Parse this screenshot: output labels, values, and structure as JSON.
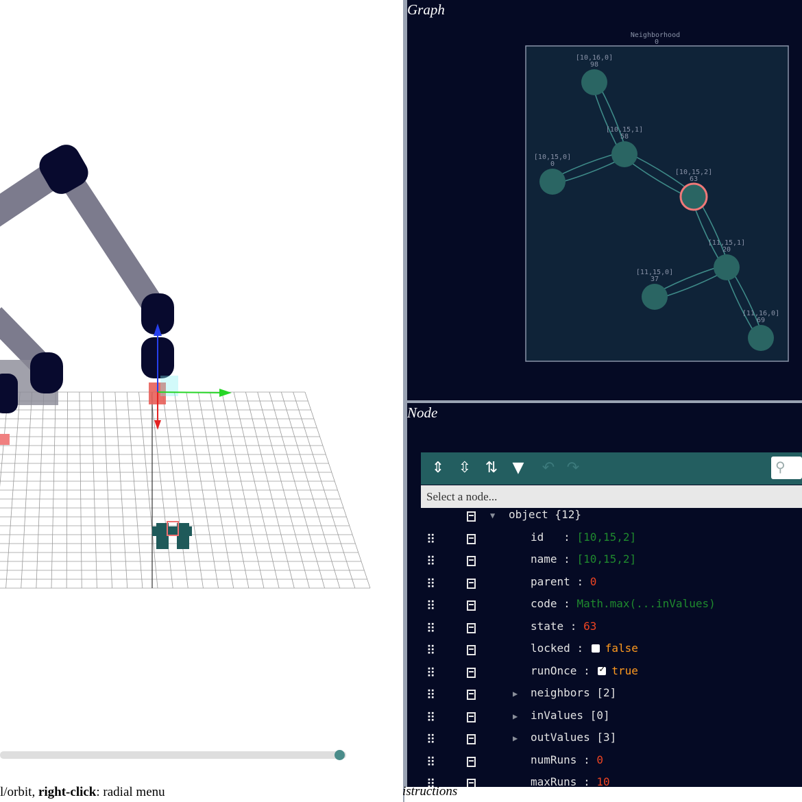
{
  "viewport": {
    "hint_prefix": "l/orbit, ",
    "hint_bold": "right-click",
    "hint_suffix": ": radial menu",
    "timeline_progress": 0.98
  },
  "graph": {
    "title": "Graph",
    "frame_title": "Neighborhood",
    "frame_subtitle": "0",
    "nodes": [
      {
        "id": "[10,16,0]",
        "value": "98"
      },
      {
        "id": "[10,15,1]",
        "value": "58"
      },
      {
        "id": "[10,15,0]",
        "value": "0"
      },
      {
        "id": "[10,15,2]",
        "value": "63",
        "selected": true
      },
      {
        "id": "[11,15,1]",
        "value": "20"
      },
      {
        "id": "[11,15,0]",
        "value": "37"
      },
      {
        "id": "[11,16,0]",
        "value": "69"
      }
    ],
    "colors": {
      "bg": "#050a24",
      "frame": "#0f2338",
      "node": "#2a6563",
      "selected": "#f07878"
    }
  },
  "node": {
    "title": "Node",
    "select_placeholder": "Select a node...",
    "toolbar": {
      "expand_icon": "expand-all-icon",
      "collapse_icon": "collapse-all-icon",
      "sort_icon": "sort-icon",
      "filter_icon": "filter-icon",
      "undo_icon": "undo-icon",
      "redo_icon": "redo-icon",
      "search_icon": "search-icon"
    },
    "tree": {
      "root_key": "object",
      "root_count": "{12}",
      "fields": [
        {
          "key": "id",
          "pad": "id   ",
          "value": "[10,15,2]",
          "type": "string"
        },
        {
          "key": "name",
          "pad": "name ",
          "value": "[10,15,2]",
          "type": "string"
        },
        {
          "key": "parent",
          "pad": "parent ",
          "value": "0",
          "type": "number"
        },
        {
          "key": "code",
          "pad": "code ",
          "value": "Math.max(...inValues)",
          "type": "string"
        },
        {
          "key": "state",
          "pad": "state ",
          "value": "63",
          "type": "number"
        },
        {
          "key": "locked",
          "pad": "locked ",
          "value": "false",
          "type": "boolean",
          "checked": false
        },
        {
          "key": "runOnce",
          "pad": "runOnce ",
          "value": "true",
          "type": "boolean",
          "checked": true
        },
        {
          "key": "neighbors",
          "pad": "neighbors",
          "value": "[2]",
          "type": "array"
        },
        {
          "key": "inValues",
          "pad": "inValues",
          "value": "[0]",
          "type": "array"
        },
        {
          "key": "outValues",
          "pad": "outValues",
          "value": "[3]",
          "type": "array"
        },
        {
          "key": "numRuns",
          "pad": "numRuns ",
          "value": "0",
          "type": "number"
        },
        {
          "key": "maxRuns",
          "pad": "maxRuns ",
          "value": "10",
          "type": "number"
        }
      ]
    },
    "footer_text": "istructions"
  }
}
